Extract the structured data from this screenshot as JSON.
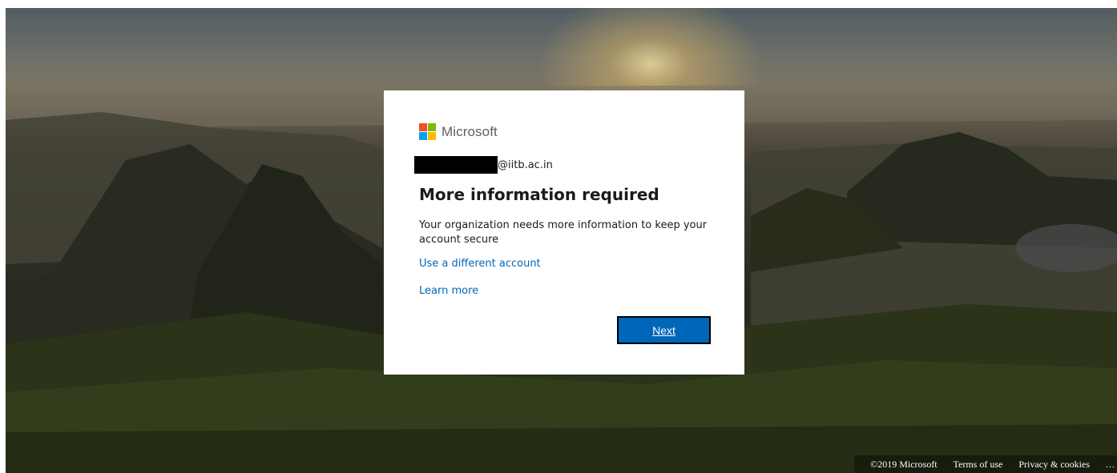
{
  "brand": {
    "name": "Microsoft",
    "logo_colors": [
      "#f25022",
      "#7fba00",
      "#00a4ef",
      "#ffb900"
    ]
  },
  "identity": {
    "email_suffix": "@iitb.ac.in",
    "redacted": true
  },
  "dialog": {
    "title": "More information required",
    "description": "Your organization needs more information to keep your account secure",
    "use_different_account": "Use a different account",
    "learn_more": "Learn more",
    "next_label": "Next"
  },
  "footer": {
    "copyright": "©2019 Microsoft",
    "terms": "Terms of use",
    "privacy": "Privacy & cookies",
    "more": "..."
  },
  "colors": {
    "accent": "#0067b8",
    "text": "#1b1b1b"
  }
}
